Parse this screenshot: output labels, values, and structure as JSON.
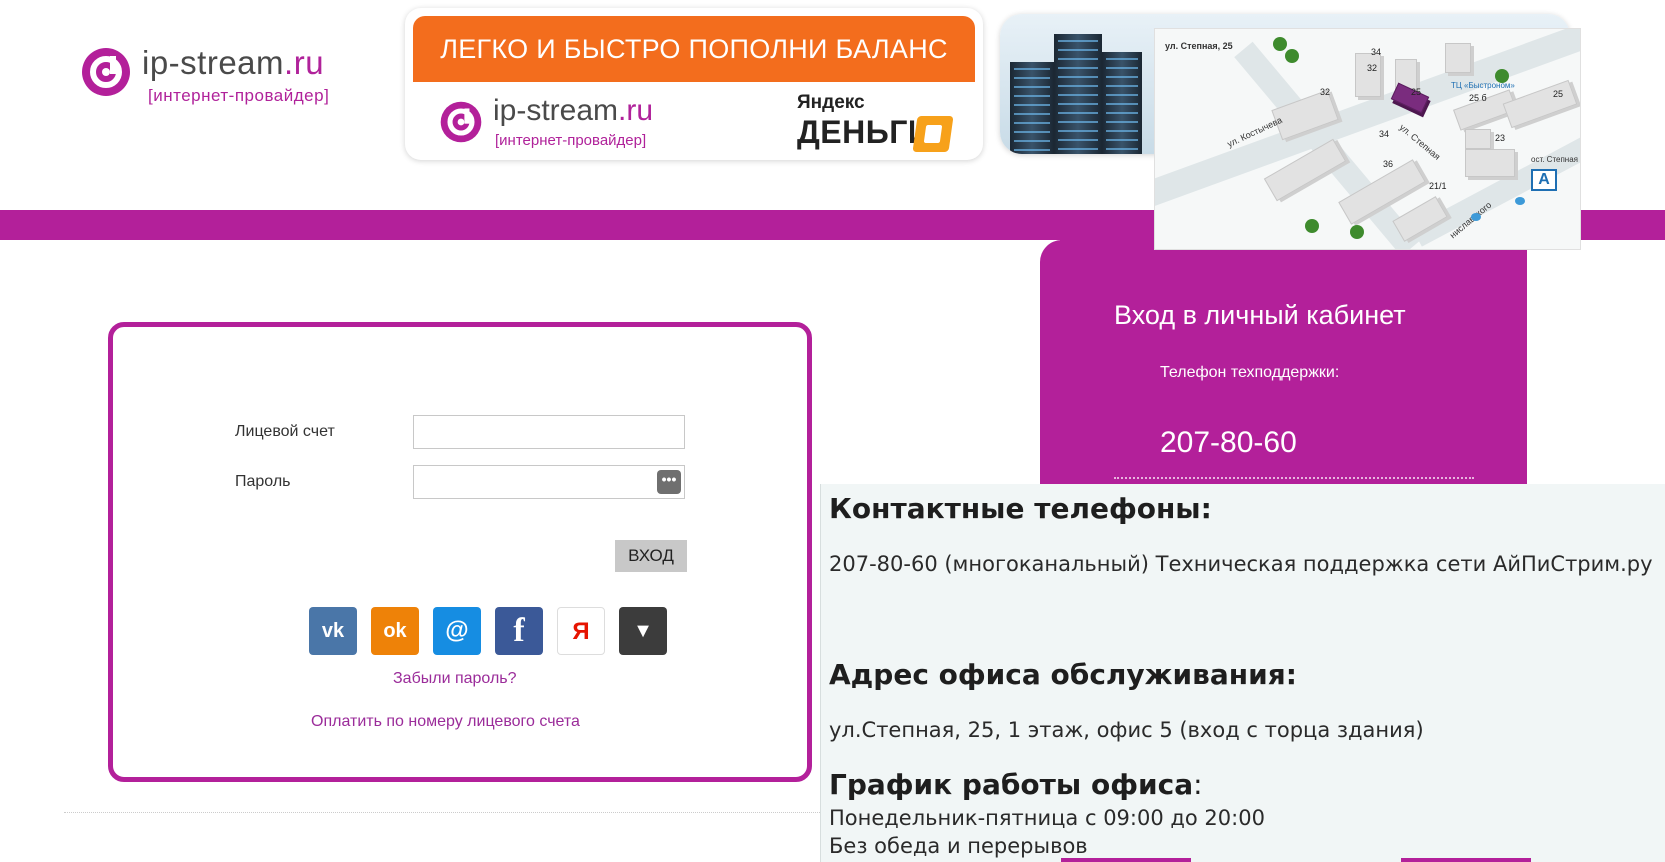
{
  "header": {
    "logo_name": "ip-stream",
    "logo_tld": ".ru",
    "logo_sub": "[интернет-провайдер]",
    "banner_pay": {
      "headline": "ЛЕГКО И БЫСТРО ПОПОЛНИ БАЛАНС",
      "logo_name": "ip-stream",
      "logo_tld": ".ru",
      "logo_sub": "[интернет-провайдер]",
      "yandex_top": "Яндекс",
      "yandex_bottom": "ДЕНЬГИ"
    },
    "map": {
      "street_stepnaya": "ул. Степная, 25",
      "street_kostycheva": "ул. Костычева",
      "street_stepnaya2": "ул. Степная",
      "street_stanislavskogo": "ниславского",
      "mall": "ТЦ «Быстроном»",
      "stop": "ост. Степная",
      "stop_letter": "A",
      "house_numbers": [
        "34",
        "32",
        "25",
        "25 б",
        "25",
        "32",
        "34",
        "23",
        "36",
        "21/1"
      ]
    }
  },
  "login": {
    "account_label": "Лицевой счет",
    "account_value": "",
    "password_label": "Пароль",
    "password_value": "",
    "password_toggle": "•••",
    "submit_label": "ВХОД",
    "social": [
      {
        "name": "vk",
        "glyph": "vk",
        "color": "#4a76a8"
      },
      {
        "name": "odnoklassniki",
        "glyph": "ok",
        "color": "#ee8208"
      },
      {
        "name": "mailru",
        "glyph": "@",
        "color": "#168de2"
      },
      {
        "name": "facebook",
        "glyph": "f",
        "color": "#3b5998"
      },
      {
        "name": "yandex",
        "glyph": "Я",
        "color": "#ffffff"
      },
      {
        "name": "more",
        "glyph": "▼",
        "color": "#3c3c3c"
      }
    ],
    "forgot_password": "Забыли пароль?",
    "pay_by_account": "Оплатить по номеру лицевого счета"
  },
  "panel": {
    "title": "Вход в личный кабинет",
    "support_label": "Телефон техподдержки:",
    "support_phone": "207-80-60"
  },
  "contacts": {
    "phones_heading": "Контактные телефоны:",
    "phones_text": "207-80-60 (многоканальный) Техническая поддержка сети АйПиСтрим.ру",
    "address_heading": "Адрес офиса обслуживания:",
    "address_text": "ул.Степная, 25, 1 этаж, офис 5 (вход с торца здания)",
    "hours_heading": "График работы офиса",
    "hours_colon": ":",
    "hours_line1": "Понедельник-пятница с 09:00 до 20:00",
    "hours_line2": "Без обеда и перерывов"
  },
  "colors": {
    "brand_purple": "#b3209a",
    "banner_orange": "#f36d1d",
    "link_purple": "#9b2c9a"
  }
}
